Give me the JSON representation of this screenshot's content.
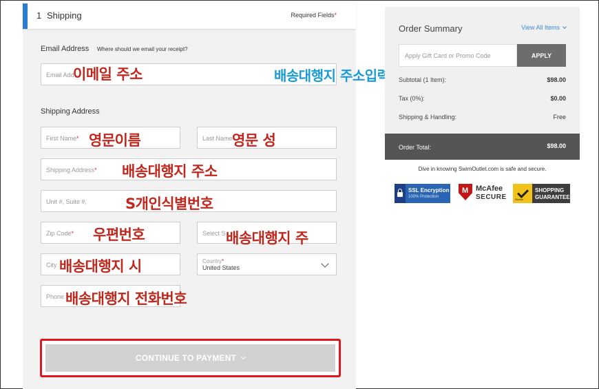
{
  "step": {
    "number": "1",
    "title": "Shipping",
    "required_text": "Required Fields",
    "required_star": "*"
  },
  "email": {
    "label": "Email Address",
    "hint": "Where should we email your receipt?",
    "placeholder": "Email Add",
    "annotation": "이메일 주소"
  },
  "top_annotation": "배송대행지 주소입력하기",
  "shipping": {
    "label": "Shipping Address",
    "first_name": {
      "placeholder": "First Name",
      "req": "*",
      "annotation": "영문이름"
    },
    "last_name": {
      "placeholder": "Last Name",
      "annotation": "영문 성"
    },
    "address": {
      "placeholder": "Shipping Address",
      "req": "*",
      "annotation": "배송대행지 주소"
    },
    "unit": {
      "placeholder": "Unit #, Suite #,",
      "annotation": "S개인식별번호"
    },
    "zip": {
      "placeholder": "Zip Code",
      "req": "*",
      "annotation": "우편번호"
    },
    "state": {
      "placeholder": "Select S",
      "annotation": "배송대행지 주"
    },
    "city": {
      "placeholder": "City",
      "annotation": "배송대행지 시"
    },
    "country": {
      "label": "Country",
      "req": "*",
      "value": "United States"
    },
    "phone": {
      "placeholder": "Phone",
      "annotation": "배송대행지 전화번호"
    }
  },
  "continue_button": "CONTINUE TO PAYMENT",
  "summary": {
    "title": "Order Summary",
    "view_all": "View All Items",
    "promo_placeholder": "Apply Gift Card or Promo Code",
    "apply": "APPLY",
    "subtotal_label": "Subtotal (1 Item):",
    "subtotal_value": "$98.00",
    "tax_label": "Tax (0%):",
    "tax_value": "$0.00",
    "shipping_label": "Shipping & Handling:",
    "shipping_value": "Free",
    "total_label": "Order Total:",
    "total_value": "$98.00"
  },
  "secure_text": "Dive in knowing SwimOutlet.com is safe and secure.",
  "badges": {
    "ssl_title": "SSL Encryption",
    "ssl_sub": "100% Protection",
    "mcafee_1": "McAfee",
    "mcafee_2": "SECURE",
    "guarantee_1": "SHOPPING",
    "guarantee_2": "GUARANTEE",
    "guarantee_small": "Norton"
  },
  "colors": {
    "accent": "#2b7cd3",
    "annotation_red": "#c0271d",
    "annotation_blue": "#1a9ad6",
    "highlight_border": "#e3151c"
  }
}
